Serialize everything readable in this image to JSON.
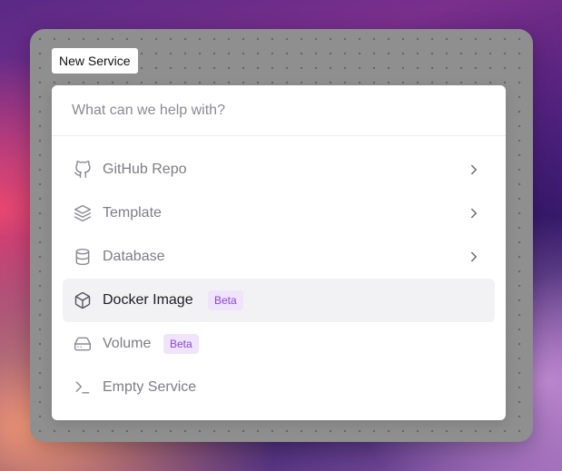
{
  "tag": {
    "label": "New Service"
  },
  "search": {
    "placeholder": "What can we help with?",
    "value": ""
  },
  "menu": {
    "items": [
      {
        "label": "GitHub Repo",
        "icon": "github-icon",
        "badge": "",
        "has_submenu": true,
        "active": false
      },
      {
        "label": "Template",
        "icon": "layers-icon",
        "badge": "",
        "has_submenu": true,
        "active": false
      },
      {
        "label": "Database",
        "icon": "database-icon",
        "badge": "",
        "has_submenu": true,
        "active": false
      },
      {
        "label": "Docker Image",
        "icon": "box-icon",
        "badge": "Beta",
        "has_submenu": false,
        "active": true
      },
      {
        "label": "Volume",
        "icon": "hard-drive-icon",
        "badge": "Beta",
        "has_submenu": false,
        "active": false
      },
      {
        "label": "Empty Service",
        "icon": "terminal-icon",
        "badge": "",
        "has_submenu": false,
        "active": false
      }
    ]
  },
  "colors": {
    "badge_bg": "#efe4fb",
    "badge_text": "#8a46d6",
    "active_row": "#f2f2f5",
    "icon": "#8a8a92"
  }
}
